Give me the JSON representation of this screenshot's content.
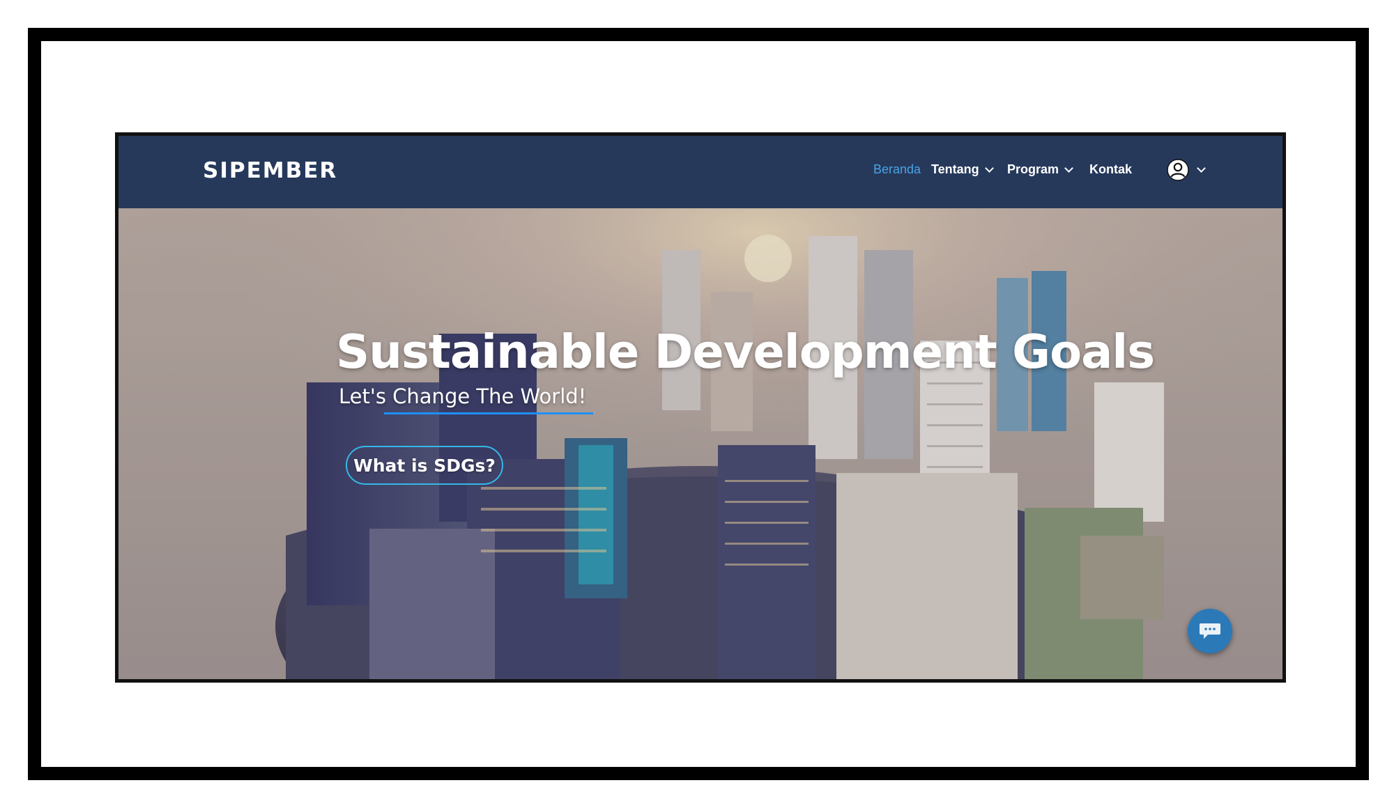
{
  "navbar": {
    "brand": "SIPEMBER",
    "items": [
      {
        "label": "Beranda",
        "active": true,
        "dropdown": false
      },
      {
        "label": "Tentang",
        "active": false,
        "dropdown": true
      },
      {
        "label": "Program",
        "active": false,
        "dropdown": true
      },
      {
        "label": "Kontak",
        "active": false,
        "dropdown": false
      }
    ],
    "user_menu_icon": "user-circle-icon"
  },
  "hero": {
    "title": "Sustainable Development Goals",
    "subtitle": "Let's Change The World!",
    "cta_label": "What is SDGs?",
    "background": "aerial-city-globe-image"
  },
  "chat_widget": {
    "icon": "chat-bubble-icon"
  },
  "colors": {
    "navbar_bg": "#26395b",
    "active_link": "#4aa3e6",
    "cta_border": "#35b8e8",
    "chat_button": "#2c79b8",
    "hero_bg": "#b6a8a1"
  }
}
